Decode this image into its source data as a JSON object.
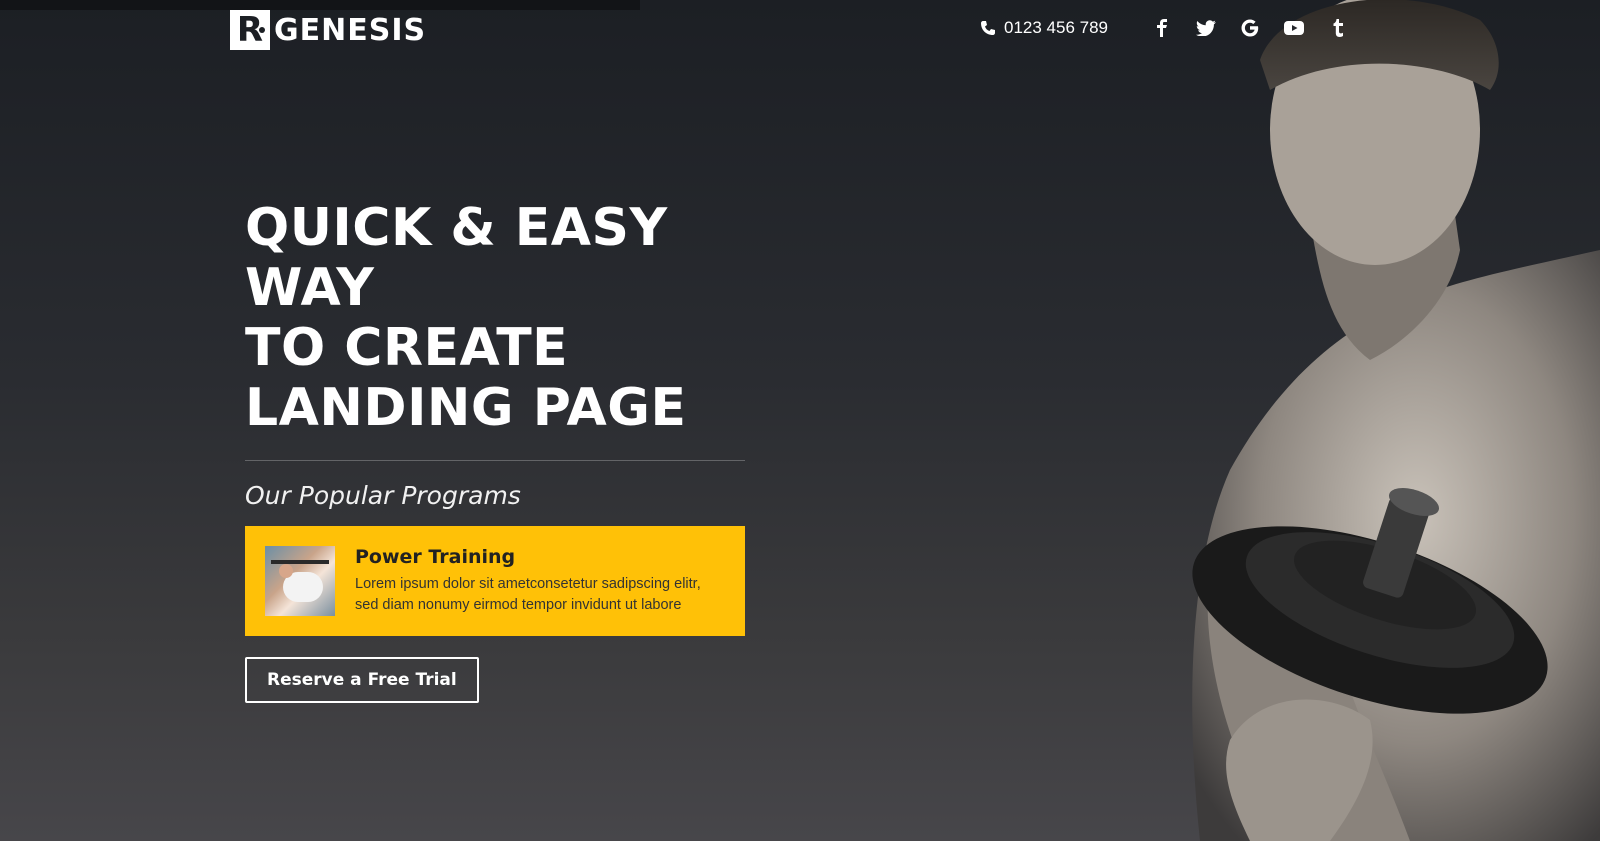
{
  "brand": {
    "logo_letter": "R",
    "name": "GENESIS"
  },
  "header": {
    "phone_icon": "phone-icon",
    "phone": "0123 456 789",
    "social": [
      {
        "name": "facebook-icon",
        "glyph": "f"
      },
      {
        "name": "twitter-icon",
        "glyph": "t"
      },
      {
        "name": "google-icon",
        "glyph": "G"
      },
      {
        "name": "youtube-icon",
        "glyph": "▶"
      },
      {
        "name": "tumblr-icon",
        "glyph": "t"
      }
    ]
  },
  "hero": {
    "title_lines": [
      "QUICK & EASY WAY",
      "TO CREATE",
      "LANDING PAGE"
    ],
    "subtitle": "Our Popular Programs",
    "program": {
      "title": "Power Training",
      "description": "Lorem ipsum dolor sit ametconsetetur sadipscing elitr, sed diam nonumy eirmod tempor invidunt ut labore"
    },
    "cta_label": "Reserve a Free Trial"
  },
  "colors": {
    "accent": "#ffc107",
    "background": "#2a2c31",
    "text": "#ffffff"
  }
}
